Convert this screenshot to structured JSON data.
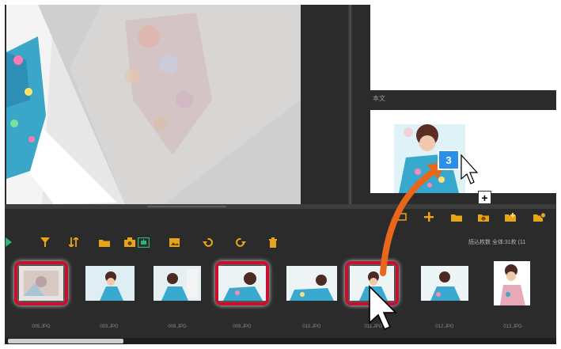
{
  "panel": {
    "caption_label": "本文"
  },
  "toolbar": {
    "play": "play-icon",
    "filter": "filter-icon",
    "sort": "sort-icon",
    "folder": "folder-icon",
    "import": "import-icon",
    "slideshow": "slideshow-icon",
    "rotate_left": "rotate-left-icon",
    "rotate_right": "rotate-right-icon",
    "delete": "trash-icon",
    "count_text": "読込枚数 全体:31枚 (11"
  },
  "right_tools": [
    "frame-icon",
    "add-icon",
    "folder-icon",
    "folder-down-icon",
    "folder-add-icon",
    "folder-settings-icon"
  ],
  "drag": {
    "badge": "3",
    "plus": "+"
  },
  "thumbnails": [
    {
      "name": "005.JPG",
      "selected": true
    },
    {
      "name": "003.JPG",
      "selected": false
    },
    {
      "name": "008.JPG",
      "selected": false
    },
    {
      "name": "009.JPG",
      "selected": true
    },
    {
      "name": "010.JPG",
      "selected": false
    },
    {
      "name": "011.JPG",
      "selected": true
    },
    {
      "name": "012.JPG",
      "selected": false
    },
    {
      "name": "013.JPG",
      "selected": false
    }
  ],
  "colors": {
    "background": "#2b2b2b",
    "selection": "#c8102e",
    "arrow": "#e8671a",
    "badge": "#2a8fe8",
    "toolbar_icon": "#e8a51a"
  }
}
